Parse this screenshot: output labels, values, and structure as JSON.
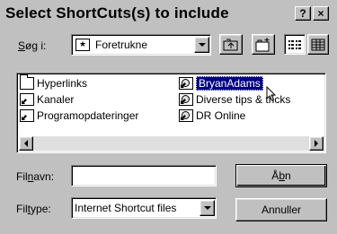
{
  "window": {
    "title": "Select ShortCuts(s) to include",
    "help_label": "?",
    "close_label": "×"
  },
  "lookin": {
    "label_prefix": "S",
    "label_rest": "øg i:",
    "value": "Foretrukne",
    "icon": "favorites-folder-icon"
  },
  "toolbar": {
    "up_icon": "up-one-level-icon",
    "new_folder_icon": "new-folder-icon",
    "list_view_icon": "list-view-icon",
    "details_view_icon": "details-view-icon"
  },
  "files": {
    "column1": [
      {
        "label": "Hyperlinks",
        "icon": "folder-icon"
      },
      {
        "label": "Kanaler",
        "icon": "shortcut-icon"
      },
      {
        "label": "Programopdateringer",
        "icon": "shortcut-icon"
      }
    ],
    "column2": [
      {
        "label": "BryanAdams",
        "icon": "internet-shortcut-icon",
        "selected": true
      },
      {
        "label": "Diverse tips & tricks",
        "icon": "internet-shortcut-icon"
      },
      {
        "label": "DR Online",
        "icon": "internet-shortcut-icon"
      }
    ]
  },
  "filename": {
    "label_a": "Fil",
    "label_u": "n",
    "label_b": "avn:",
    "value": ""
  },
  "filetype": {
    "label_a": "Fil",
    "label_u": "t",
    "label_b": "ype:",
    "value": "Internet Shortcut files"
  },
  "buttons": {
    "open_a": "Å",
    "open_u": "b",
    "open_b": "n",
    "cancel": "Annuller"
  }
}
